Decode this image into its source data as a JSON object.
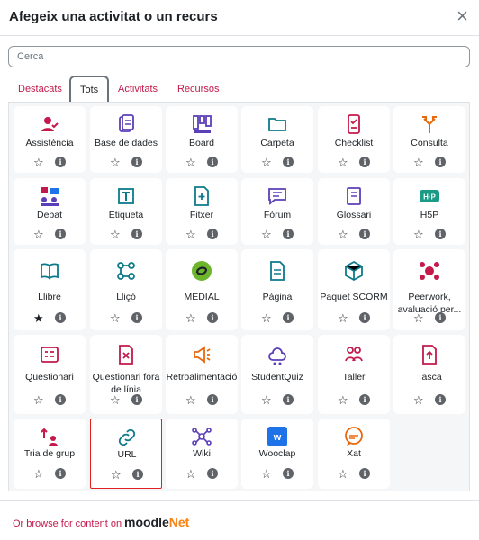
{
  "dialog": {
    "title": "Afegeix una activitat o un recurs",
    "close": "×"
  },
  "search": {
    "placeholder": "Cerca",
    "value": ""
  },
  "tabs": [
    {
      "label": "Destacats",
      "active": false
    },
    {
      "label": "Tots",
      "active": true
    },
    {
      "label": "Activitats",
      "active": false
    },
    {
      "label": "Recursos",
      "active": false
    }
  ],
  "items": [
    {
      "name": "Assistència",
      "icon": "attendance-icon",
      "color": "#c3194b",
      "starred": false
    },
    {
      "name": "Base de dades",
      "icon": "database-icon",
      "color": "#5b3fb8",
      "starred": false
    },
    {
      "name": "Board",
      "icon": "board-icon",
      "color": "#5b3fb8",
      "starred": false
    },
    {
      "name": "Carpeta",
      "icon": "folder-icon",
      "color": "#0d7a8a",
      "starred": false
    },
    {
      "name": "Checklist",
      "icon": "checklist-icon",
      "color": "#c3194b",
      "starred": false
    },
    {
      "name": "Consulta",
      "icon": "choice-icon",
      "color": "#e8680c",
      "starred": false
    },
    {
      "name": "Debat",
      "icon": "debate-icon",
      "color": "#5b3fb8",
      "starred": false
    },
    {
      "name": "Etiqueta",
      "icon": "label-icon",
      "color": "#0d7a8a",
      "starred": false
    },
    {
      "name": "Fitxer",
      "icon": "file-icon",
      "color": "#0d7a8a",
      "starred": false
    },
    {
      "name": "Fòrum",
      "icon": "forum-icon",
      "color": "#5b3fb8",
      "starred": false
    },
    {
      "name": "Glossari",
      "icon": "glossary-icon",
      "color": "#5b3fb8",
      "starred": false
    },
    {
      "name": "H5P",
      "icon": "h5p-icon",
      "color": "#1a9b86",
      "starred": false
    },
    {
      "name": "Llibre",
      "icon": "book-icon",
      "color": "#0d7a8a",
      "starred": true
    },
    {
      "name": "Lliçó",
      "icon": "lesson-icon",
      "color": "#0d7a8a",
      "starred": false
    },
    {
      "name": "MEDIAL",
      "icon": "medial-icon",
      "color": "#6cb52d",
      "starred": false
    },
    {
      "name": "Pàgina",
      "icon": "page-icon",
      "color": "#0d7a8a",
      "starred": false
    },
    {
      "name": "Paquet SCORM",
      "icon": "scorm-icon",
      "color": "#0d7a8a",
      "starred": false
    },
    {
      "name": "Peerwork, avaluació per...",
      "icon": "peerwork-icon",
      "color": "#c3194b",
      "starred": false
    },
    {
      "name": "Qüestionari",
      "icon": "quiz-icon",
      "color": "#c3194b",
      "starred": false
    },
    {
      "name": "Qüestionari fora de línia",
      "icon": "offline-quiz-icon",
      "color": "#c3194b",
      "starred": false
    },
    {
      "name": "Retroalimentació",
      "icon": "feedback-icon",
      "color": "#e8680c",
      "starred": false
    },
    {
      "name": "StudentQuiz",
      "icon": "studentquiz-icon",
      "color": "#5b3fb8",
      "starred": false
    },
    {
      "name": "Taller",
      "icon": "workshop-icon",
      "color": "#c3194b",
      "starred": false
    },
    {
      "name": "Tasca",
      "icon": "assignment-icon",
      "color": "#c3194b",
      "starred": false
    },
    {
      "name": "Tria de grup",
      "icon": "group-choice-icon",
      "color": "#c3194b",
      "starred": false
    },
    {
      "name": "URL",
      "icon": "link-icon",
      "color": "#0d7a8a",
      "starred": false,
      "selected": true
    },
    {
      "name": "Wiki",
      "icon": "wiki-icon",
      "color": "#5b3fb8",
      "starred": false
    },
    {
      "name": "Wooclap",
      "icon": "wooclap-icon",
      "color": "#1e73e8",
      "starred": false
    },
    {
      "name": "Xat",
      "icon": "chat-icon",
      "color": "#e8680c",
      "starred": false
    }
  ],
  "footer": {
    "browse_text": "Or browse for content on",
    "brand_moodle": "moodle",
    "brand_net": "Net"
  }
}
